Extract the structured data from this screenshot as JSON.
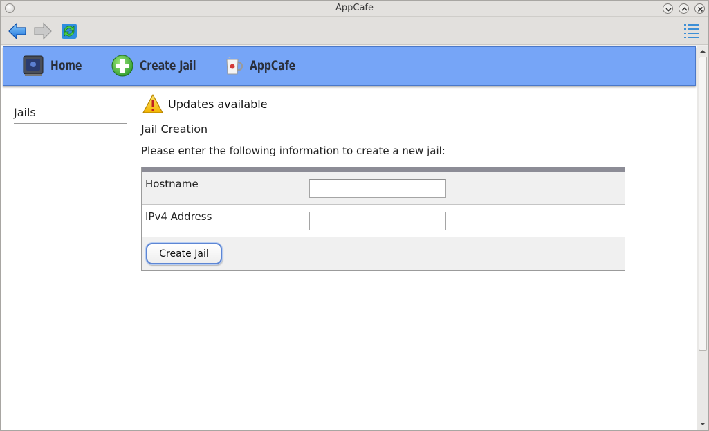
{
  "window": {
    "title": "AppCafe"
  },
  "toolbar": {
    "back_icon": "back-arrow-icon",
    "forward_icon": "forward-arrow-icon",
    "refresh_icon": "refresh-icon",
    "menu_icon": "hamburger-menu-icon"
  },
  "nav": {
    "items": [
      {
        "label": "Home",
        "icon": "home-tv-icon"
      },
      {
        "label": "Create Jail",
        "icon": "add-plus-icon"
      },
      {
        "label": "AppCafe",
        "icon": "cafe-mug-icon"
      }
    ],
    "background": "#76a5f7"
  },
  "sidebar": {
    "title": "Jails"
  },
  "main": {
    "updates_link": "Updates available",
    "section_title": "Jail Creation",
    "instructions": "Please enter the following information to create a new jail:",
    "form": {
      "fields": [
        {
          "label": "Hostname",
          "value": ""
        },
        {
          "label": "IPv4 Address",
          "value": ""
        }
      ],
      "submit_label": "Create Jail"
    }
  }
}
